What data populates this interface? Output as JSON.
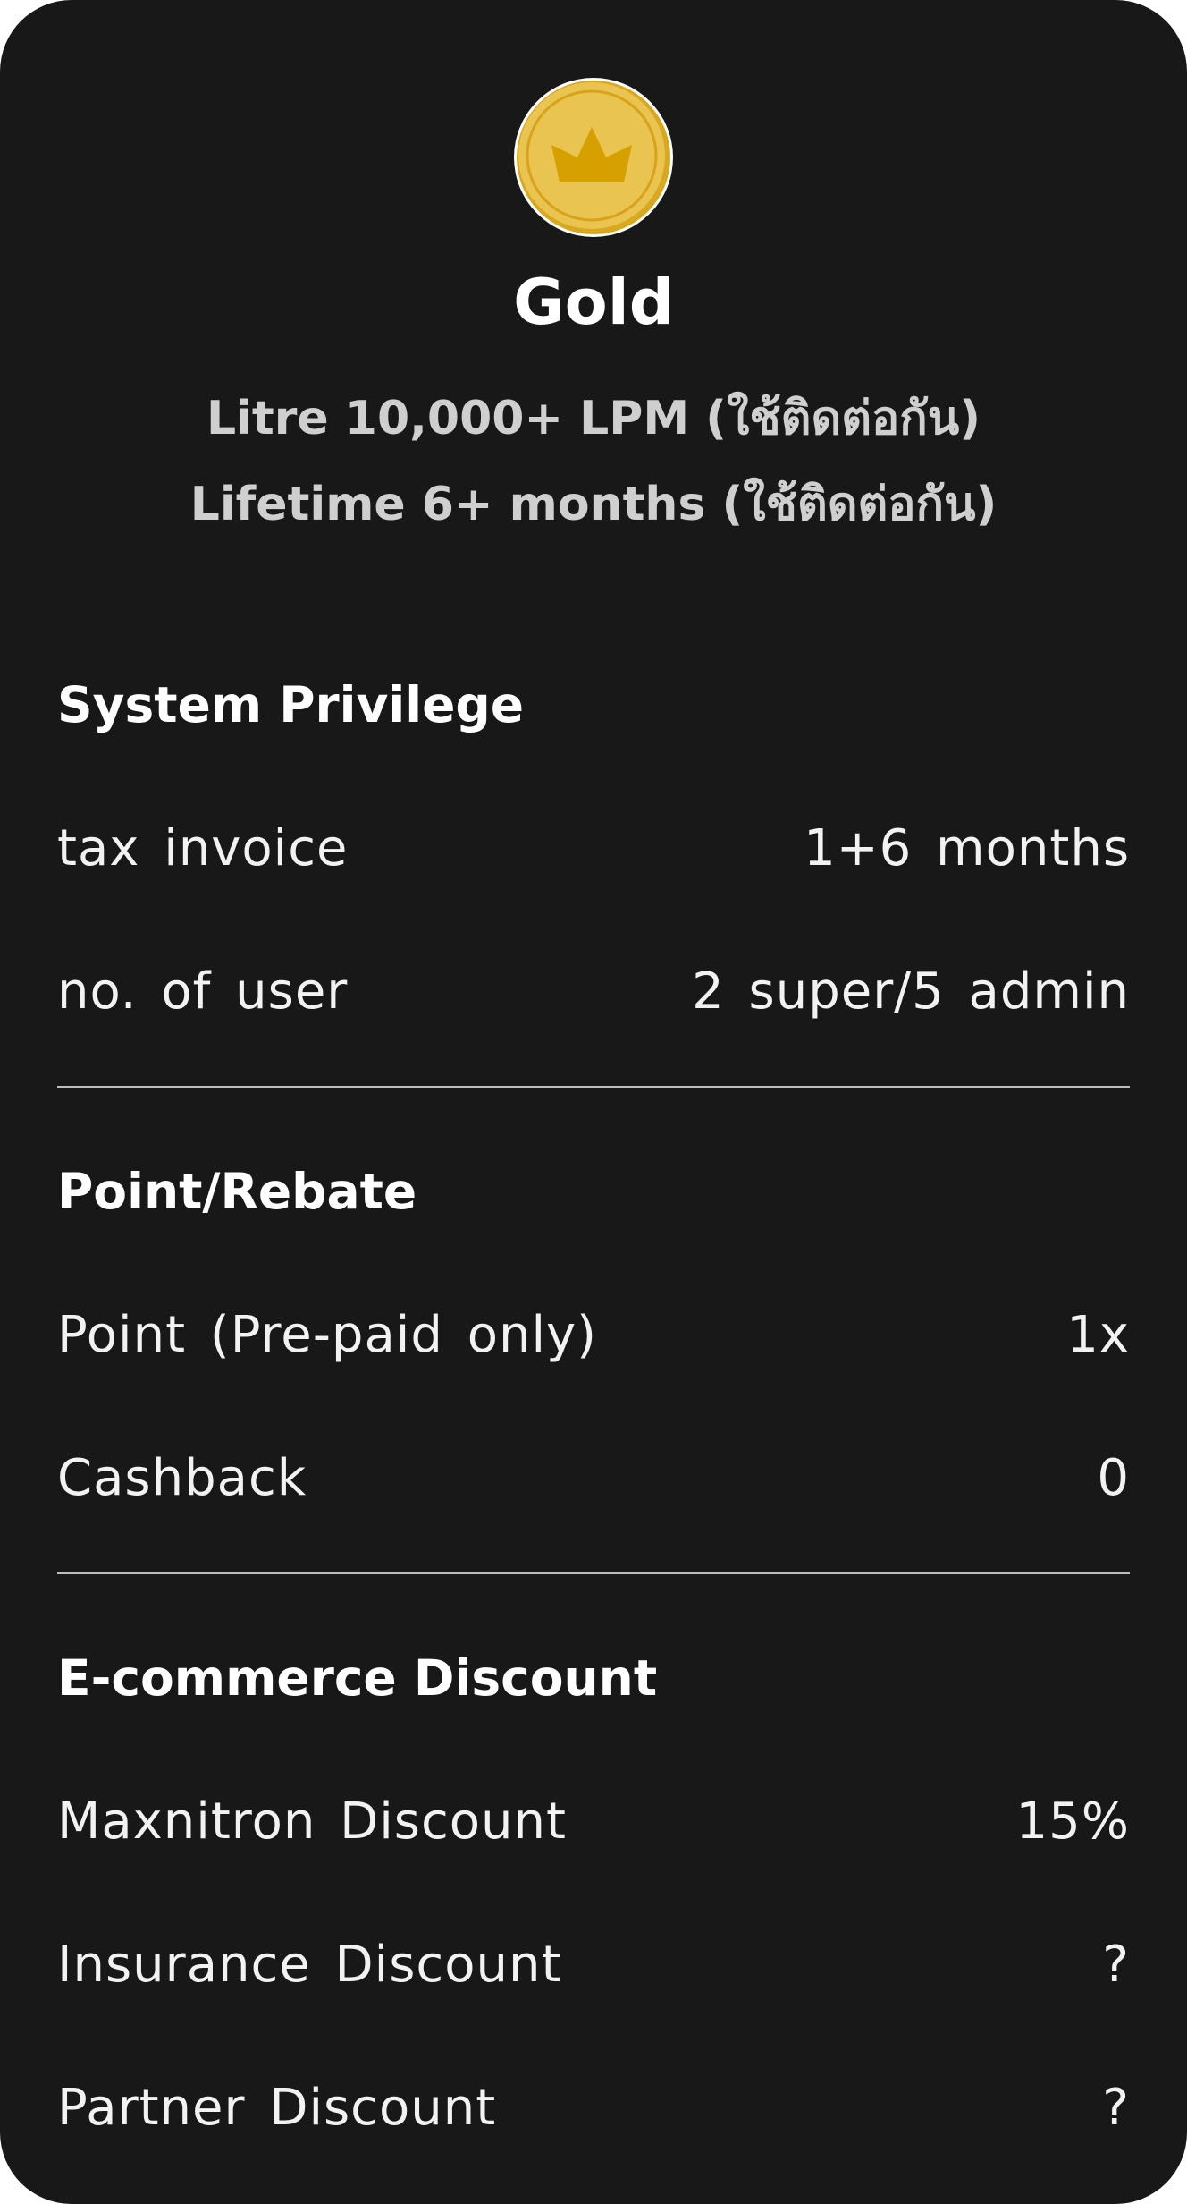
{
  "tier": {
    "name": "Gold",
    "medal_icon": "crown-medal-icon",
    "medal_color": "#E6C04A",
    "requirements": [
      "Litre 10,000+ LPM (ใช้ติดต่อกัน)",
      "Lifetime 6+ months (ใช้ติดต่อกัน)"
    ]
  },
  "sections": [
    {
      "title": "System Privilege",
      "rows": [
        {
          "label": "tax invoice",
          "value": "1+6 months"
        },
        {
          "label": "no. of user",
          "value": "2 super/5 admin"
        }
      ]
    },
    {
      "title": "Point/Rebate",
      "rows": [
        {
          "label": "Point (Pre-paid only)",
          "value": "1x"
        },
        {
          "label": "Cashback",
          "value": "0"
        }
      ]
    },
    {
      "title": "E-commerce Discount",
      "rows": [
        {
          "label": "Maxnitron Discount",
          "value": "15%"
        },
        {
          "label": "Insurance Discount",
          "value": "?"
        },
        {
          "label": "Partner Discount",
          "value": "?"
        }
      ]
    }
  ],
  "colors": {
    "card_background": "#181818",
    "text_primary": "#FFFFFF",
    "text_secondary": "#CFCFCF",
    "divider": "#BDBDBD"
  }
}
